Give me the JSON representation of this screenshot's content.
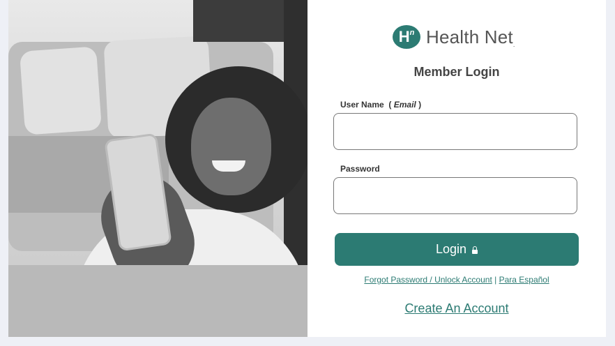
{
  "brand": {
    "logo_mark": "H",
    "logo_mark_sup": "n",
    "name": "Health Net",
    "tm": ".",
    "accent_color": "#2c7b73"
  },
  "login": {
    "title": "Member Login",
    "username_label": "User Name",
    "username_hint_open": "(",
    "username_hint": "Email",
    "username_hint_close": ")",
    "username_value": "",
    "password_label": "Password",
    "password_value": "",
    "login_button": "Login",
    "login_icon": "lock-icon"
  },
  "links": {
    "forgot": "Forgot Password / Unlock Account",
    "separator": "|",
    "spanish": "Para Español",
    "create_account": "Create An Account"
  },
  "hero_image": {
    "description_icon": "woman-with-phone-photo"
  }
}
